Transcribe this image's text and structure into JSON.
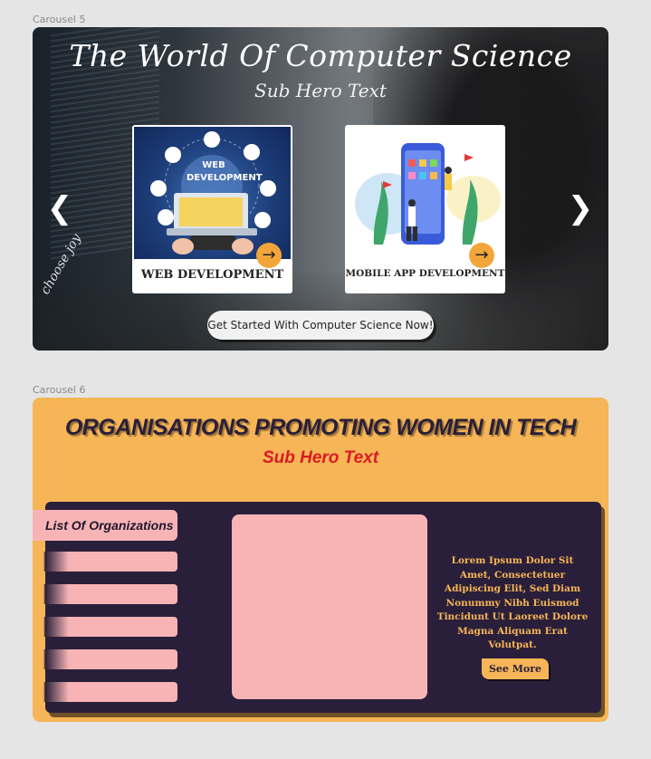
{
  "frames": {
    "carousel5_label": "Carousel 5",
    "carousel6_label": "Carousel 6"
  },
  "carousel5": {
    "title": "The World Of Computer Science",
    "subtitle": "Sub Hero Text",
    "prev_icon": "chevron-left-icon",
    "next_icon": "chevron-right-icon",
    "cards": [
      {
        "caption": "WEB DEVELOPMENT",
        "image_label": "WEB DEVELOPMENT"
      },
      {
        "caption": "MOBILE APP DEVELOPMENT"
      }
    ],
    "cta_label": "Get Started With Computer Science Now!",
    "background_text": "choose joy"
  },
  "carousel6": {
    "title": "ORGANISATIONS PROMOTING WOMEN IN TECH",
    "subtitle": "Sub Hero Text",
    "list_heading": "List Of Organizations",
    "body_text": "Lorem Ipsum Dolor Sit Amet, Consectetuer Adipiscing Elit, Sed Diam Nonummy Nibh Euismod Tincidunt Ut Laoreet Dolore Magna Aliquam Erat Volutpat.",
    "button_label": "See More"
  },
  "colors": {
    "accent_orange": "#f6b556",
    "dark_purple": "#2a1f3a",
    "pink": "#f8b4b5",
    "red": "#d91b24"
  }
}
